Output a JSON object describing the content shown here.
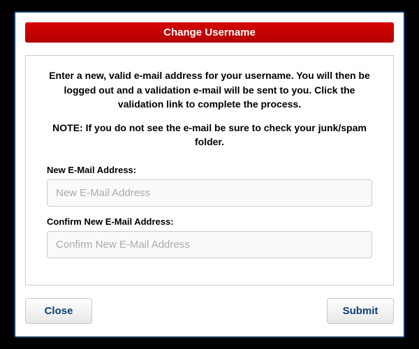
{
  "dialog": {
    "title": "Change Username",
    "instructions": "Enter a new, valid e-mail address for your username. You will then be logged out and a validation e-mail will be sent to you. Click the validation link to complete the process.",
    "note": "NOTE: If you do not see the e-mail be sure to check your junk/spam folder.",
    "fields": {
      "new_email": {
        "label": "New E-Mail Address:",
        "placeholder": "New E-Mail Address",
        "value": ""
      },
      "confirm_email": {
        "label": "Confirm New E-Mail Address:",
        "placeholder": "Confirm New E-Mail Address",
        "value": ""
      }
    },
    "buttons": {
      "close": "Close",
      "submit": "Submit"
    }
  }
}
